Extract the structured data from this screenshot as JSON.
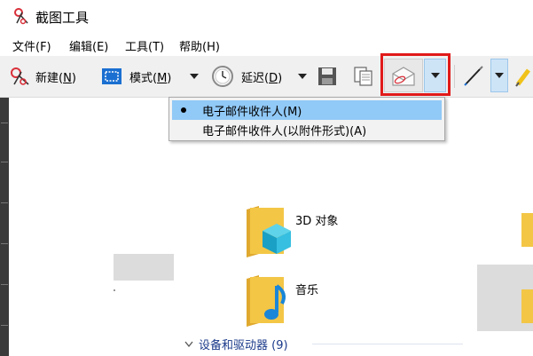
{
  "window": {
    "title": "截图工具"
  },
  "menu": {
    "items": [
      {
        "label": "文件(F)"
      },
      {
        "label": "编辑(E)"
      },
      {
        "label": "工具(T)"
      },
      {
        "label": "帮助(H)"
      }
    ]
  },
  "toolbar": {
    "new_label": "新建(",
    "new_key": "N",
    "new_suffix": ")",
    "mode_label": "模式(",
    "mode_key": "M",
    "mode_suffix": ")",
    "delay_label": "延迟(",
    "delay_key": "D",
    "delay_suffix": ")"
  },
  "dropdown": {
    "items": [
      {
        "label": "电子邮件收件人(M)",
        "selected": true
      },
      {
        "label": "电子邮件收件人(以附件形式)(A)",
        "selected": false
      }
    ]
  },
  "explorer": {
    "items": [
      {
        "label": "3D 对象"
      },
      {
        "label": "音乐"
      }
    ],
    "section_header": "设备和驱动器 (9)"
  },
  "colors": {
    "highlight_red": "#e11a1a",
    "selected_blue": "#91c9f7",
    "folder_yellow": "#f3c646",
    "section_header": "#1b3a8a"
  }
}
